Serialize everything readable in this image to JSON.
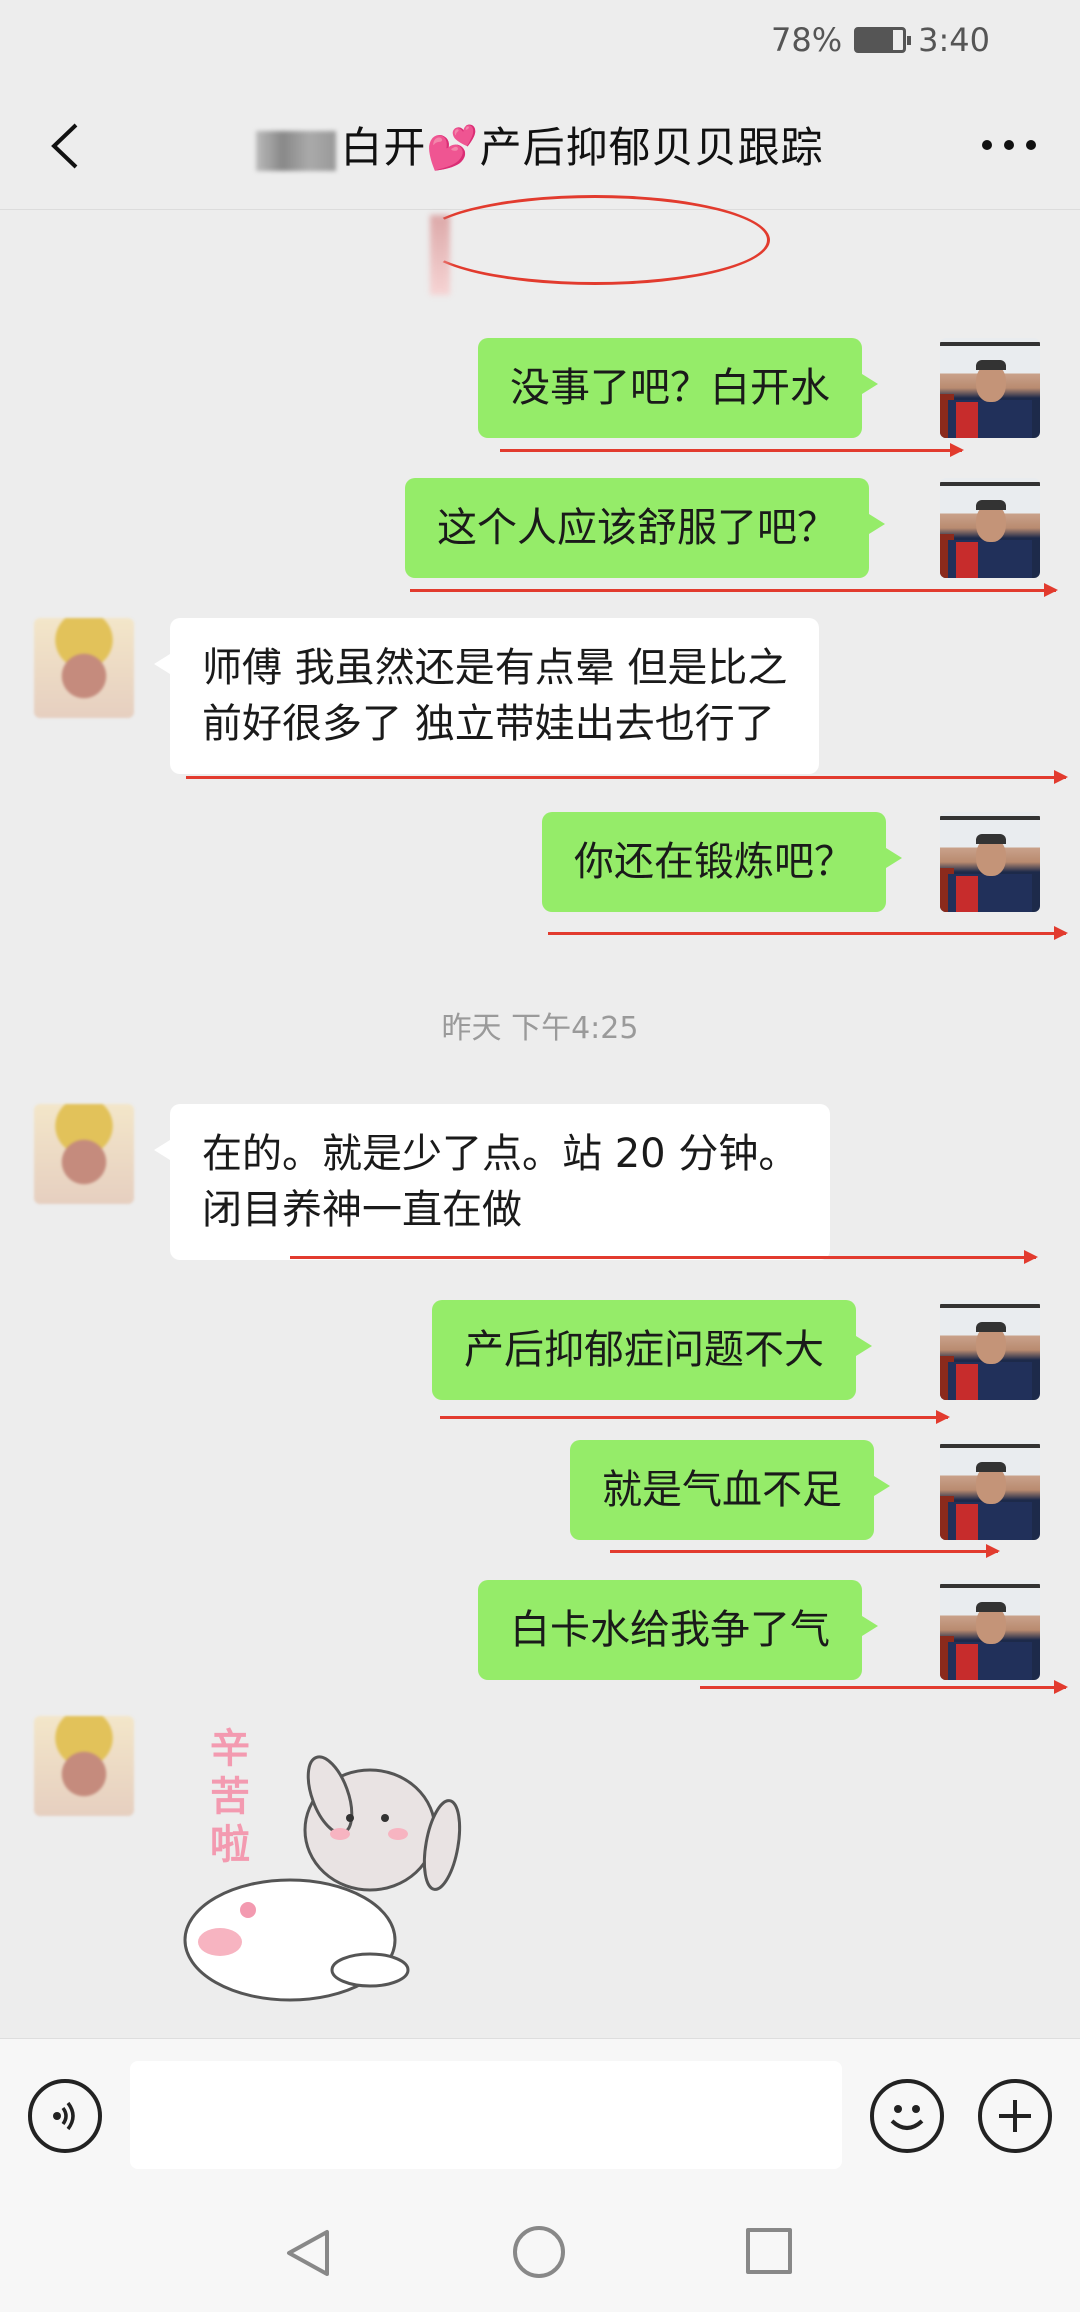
{
  "status_bar": {
    "battery": "78%",
    "time": "3:40"
  },
  "header": {
    "title_suffix": "白开💕产后抑郁贝贝跟踪",
    "back_icon": "chevron-left-icon",
    "more_icon": "more-dots-icon"
  },
  "messages": [
    {
      "side": "out",
      "text": "没事了吧？白开水"
    },
    {
      "side": "out",
      "text": "这个人应该舒服了吧？"
    },
    {
      "side": "in",
      "lines": [
        "师傅 我虽然还是有点晕 但是比之",
        "前好很多了  独立带娃出去也行了"
      ]
    },
    {
      "side": "out",
      "text": "你还在锻炼吧？"
    },
    {
      "side": "in",
      "lines": [
        "在的。就是少了点。站 20 分钟。",
        "闭目养神一直在做"
      ]
    },
    {
      "side": "out",
      "text": "产后抑郁症问题不大"
    },
    {
      "side": "out",
      "text": "就是气血不足"
    },
    {
      "side": "out",
      "text": "白卡水给我争了气"
    }
  ],
  "timestamp": "昨天 下午4:25",
  "sticker": {
    "text": "辛苦啦"
  },
  "input_bar": {
    "voice_icon": "voice-icon",
    "emoji_icon": "emoji-icon",
    "plus_icon": "plus-icon",
    "input_value": ""
  },
  "nav_bar": {
    "back": "nav-back-icon",
    "home": "nav-home-icon",
    "recent": "nav-recent-icon"
  },
  "colors": {
    "outgoing_bubble": "#95ec69",
    "incoming_bubble": "#ffffff",
    "annotation": "#e23b2e",
    "background": "#ededed"
  }
}
